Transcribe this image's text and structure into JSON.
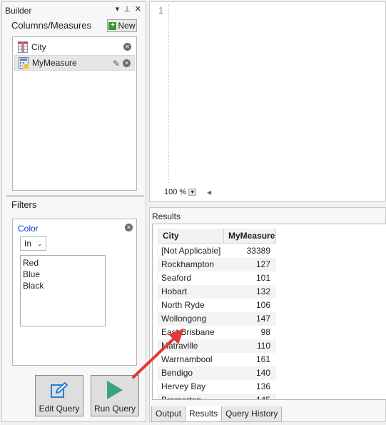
{
  "builder": {
    "title": "Builder",
    "title_buttons": [
      "▾",
      "⊥",
      "✕"
    ],
    "columns_label": "Columns/Measures",
    "new_button": "New",
    "columns": [
      {
        "label": "City",
        "icon": "table-column-icon"
      },
      {
        "label": "MyMeasure",
        "icon": "calculator-measure-icon"
      }
    ],
    "filters_label": "Filters",
    "filter": {
      "field": "Color",
      "operator": "In",
      "values": [
        "Red",
        "Blue",
        "Black"
      ]
    },
    "edit_query_button": "Edit Query",
    "run_query_button": "Run Query"
  },
  "editor": {
    "line_number": "1",
    "zoom": "100 %"
  },
  "results": {
    "title": "Results",
    "columns": [
      "City",
      "MyMeasure"
    ],
    "rows": [
      {
        "city": "[Not Applicable]",
        "measure": "33389"
      },
      {
        "city": "Rockhampton",
        "measure": "127"
      },
      {
        "city": "Seaford",
        "measure": "101"
      },
      {
        "city": "Hobart",
        "measure": "132"
      },
      {
        "city": "North Ryde",
        "measure": "106"
      },
      {
        "city": "Wollongong",
        "measure": "147"
      },
      {
        "city": "East Brisbane",
        "measure": "98"
      },
      {
        "city": "Matraville",
        "measure": "110"
      },
      {
        "city": "Warrnambool",
        "measure": "161"
      },
      {
        "city": "Bendigo",
        "measure": "140"
      },
      {
        "city": "Hervey Bay",
        "measure": "136"
      },
      {
        "city": "Bremerton",
        "measure": "145"
      }
    ],
    "tabs": [
      "Output",
      "Results",
      "Query History"
    ],
    "active_tab": "Results"
  },
  "colors": {
    "accent_blue": "#0a3bd6",
    "arrow_red": "#e03a3a",
    "run_green": "#3aa382",
    "edit_blue": "#2a7fd4"
  }
}
